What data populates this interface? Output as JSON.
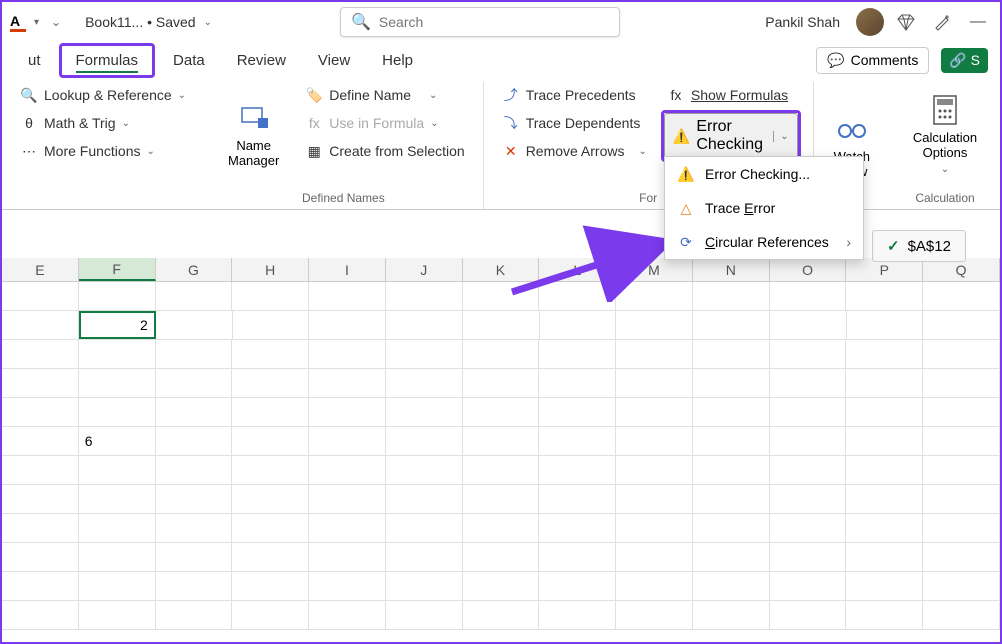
{
  "titlebar": {
    "font_letter": "A",
    "doc_status": "Book11... • Saved",
    "search_placeholder": "Search",
    "user_name": "Pankil Shah"
  },
  "tabs": {
    "items": [
      "ut",
      "Formulas",
      "Data",
      "Review",
      "View",
      "Help"
    ],
    "comments": "Comments",
    "share": "S"
  },
  "ribbon": {
    "lookup": "Lookup & Reference",
    "math": "Math & Trig",
    "more": "More Functions",
    "name_mgr": "Name Manager",
    "define": "Define Name",
    "use_formula": "Use in Formula",
    "create_sel": "Create from Selection",
    "defined_label": "Defined Names",
    "trace_prec": "Trace Precedents",
    "trace_dep": "Trace Dependents",
    "remove_arrows": "Remove Arrows",
    "show_formulas": "Show Formulas",
    "error_checking": "Error Checking",
    "formula_label": "For",
    "watch": "Watch\nndow",
    "calc_opts": "Calculation Options",
    "calc_label": "Calculation"
  },
  "dropdown": {
    "err_check": "Error Checking...",
    "trace_err": "Trace Error",
    "circular": "Circular References"
  },
  "cell_ref": "$A$12",
  "grid": {
    "columns": [
      "E",
      "F",
      "G",
      "H",
      "I",
      "J",
      "K",
      "L",
      "M",
      "N",
      "O",
      "P",
      "Q"
    ],
    "selected_col": 1,
    "active_cell_value": "2",
    "other_value": "6"
  }
}
